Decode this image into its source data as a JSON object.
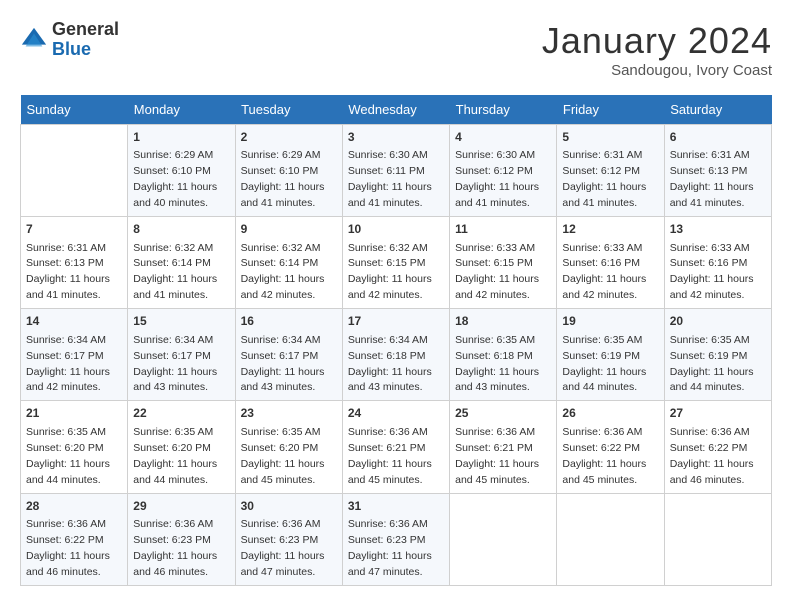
{
  "logo": {
    "general": "General",
    "blue": "Blue"
  },
  "header": {
    "month": "January 2024",
    "location": "Sandougou, Ivory Coast"
  },
  "weekdays": [
    "Sunday",
    "Monday",
    "Tuesday",
    "Wednesday",
    "Thursday",
    "Friday",
    "Saturday"
  ],
  "weeks": [
    [
      {
        "day": "",
        "info": ""
      },
      {
        "day": "1",
        "info": "Sunrise: 6:29 AM\nSunset: 6:10 PM\nDaylight: 11 hours\nand 40 minutes."
      },
      {
        "day": "2",
        "info": "Sunrise: 6:29 AM\nSunset: 6:10 PM\nDaylight: 11 hours\nand 41 minutes."
      },
      {
        "day": "3",
        "info": "Sunrise: 6:30 AM\nSunset: 6:11 PM\nDaylight: 11 hours\nand 41 minutes."
      },
      {
        "day": "4",
        "info": "Sunrise: 6:30 AM\nSunset: 6:12 PM\nDaylight: 11 hours\nand 41 minutes."
      },
      {
        "day": "5",
        "info": "Sunrise: 6:31 AM\nSunset: 6:12 PM\nDaylight: 11 hours\nand 41 minutes."
      },
      {
        "day": "6",
        "info": "Sunrise: 6:31 AM\nSunset: 6:13 PM\nDaylight: 11 hours\nand 41 minutes."
      }
    ],
    [
      {
        "day": "7",
        "info": "Sunrise: 6:31 AM\nSunset: 6:13 PM\nDaylight: 11 hours\nand 41 minutes."
      },
      {
        "day": "8",
        "info": "Sunrise: 6:32 AM\nSunset: 6:14 PM\nDaylight: 11 hours\nand 41 minutes."
      },
      {
        "day": "9",
        "info": "Sunrise: 6:32 AM\nSunset: 6:14 PM\nDaylight: 11 hours\nand 42 minutes."
      },
      {
        "day": "10",
        "info": "Sunrise: 6:32 AM\nSunset: 6:15 PM\nDaylight: 11 hours\nand 42 minutes."
      },
      {
        "day": "11",
        "info": "Sunrise: 6:33 AM\nSunset: 6:15 PM\nDaylight: 11 hours\nand 42 minutes."
      },
      {
        "day": "12",
        "info": "Sunrise: 6:33 AM\nSunset: 6:16 PM\nDaylight: 11 hours\nand 42 minutes."
      },
      {
        "day": "13",
        "info": "Sunrise: 6:33 AM\nSunset: 6:16 PM\nDaylight: 11 hours\nand 42 minutes."
      }
    ],
    [
      {
        "day": "14",
        "info": "Sunrise: 6:34 AM\nSunset: 6:17 PM\nDaylight: 11 hours\nand 42 minutes."
      },
      {
        "day": "15",
        "info": "Sunrise: 6:34 AM\nSunset: 6:17 PM\nDaylight: 11 hours\nand 43 minutes."
      },
      {
        "day": "16",
        "info": "Sunrise: 6:34 AM\nSunset: 6:17 PM\nDaylight: 11 hours\nand 43 minutes."
      },
      {
        "day": "17",
        "info": "Sunrise: 6:34 AM\nSunset: 6:18 PM\nDaylight: 11 hours\nand 43 minutes."
      },
      {
        "day": "18",
        "info": "Sunrise: 6:35 AM\nSunset: 6:18 PM\nDaylight: 11 hours\nand 43 minutes."
      },
      {
        "day": "19",
        "info": "Sunrise: 6:35 AM\nSunset: 6:19 PM\nDaylight: 11 hours\nand 44 minutes."
      },
      {
        "day": "20",
        "info": "Sunrise: 6:35 AM\nSunset: 6:19 PM\nDaylight: 11 hours\nand 44 minutes."
      }
    ],
    [
      {
        "day": "21",
        "info": "Sunrise: 6:35 AM\nSunset: 6:20 PM\nDaylight: 11 hours\nand 44 minutes."
      },
      {
        "day": "22",
        "info": "Sunrise: 6:35 AM\nSunset: 6:20 PM\nDaylight: 11 hours\nand 44 minutes."
      },
      {
        "day": "23",
        "info": "Sunrise: 6:35 AM\nSunset: 6:20 PM\nDaylight: 11 hours\nand 45 minutes."
      },
      {
        "day": "24",
        "info": "Sunrise: 6:36 AM\nSunset: 6:21 PM\nDaylight: 11 hours\nand 45 minutes."
      },
      {
        "day": "25",
        "info": "Sunrise: 6:36 AM\nSunset: 6:21 PM\nDaylight: 11 hours\nand 45 minutes."
      },
      {
        "day": "26",
        "info": "Sunrise: 6:36 AM\nSunset: 6:22 PM\nDaylight: 11 hours\nand 45 minutes."
      },
      {
        "day": "27",
        "info": "Sunrise: 6:36 AM\nSunset: 6:22 PM\nDaylight: 11 hours\nand 46 minutes."
      }
    ],
    [
      {
        "day": "28",
        "info": "Sunrise: 6:36 AM\nSunset: 6:22 PM\nDaylight: 11 hours\nand 46 minutes."
      },
      {
        "day": "29",
        "info": "Sunrise: 6:36 AM\nSunset: 6:23 PM\nDaylight: 11 hours\nand 46 minutes."
      },
      {
        "day": "30",
        "info": "Sunrise: 6:36 AM\nSunset: 6:23 PM\nDaylight: 11 hours\nand 47 minutes."
      },
      {
        "day": "31",
        "info": "Sunrise: 6:36 AM\nSunset: 6:23 PM\nDaylight: 11 hours\nand 47 minutes."
      },
      {
        "day": "",
        "info": ""
      },
      {
        "day": "",
        "info": ""
      },
      {
        "day": "",
        "info": ""
      }
    ]
  ]
}
